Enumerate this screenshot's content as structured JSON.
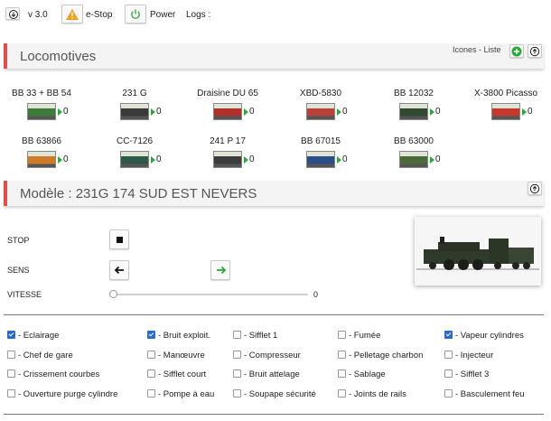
{
  "topbar": {
    "version": "v 3.0",
    "estop_label": "e-Stop",
    "power_label": "Power",
    "logs_label": "Logs :"
  },
  "locomotives_section": {
    "title": "Locomotives",
    "view_toggle": "Icones - Liste"
  },
  "locomotives": [
    {
      "name": "BB 33 + BB 54",
      "count": "0",
      "color": "#3e7a3a"
    },
    {
      "name": "231 G",
      "count": "0",
      "color": "#3a3a3a"
    },
    {
      "name": "Draisine DU 65",
      "count": "0",
      "color": "#b0302c"
    },
    {
      "name": "XBD-5830",
      "count": "0",
      "color": "#b8413a"
    },
    {
      "name": "BB 12032",
      "count": "0",
      "color": "#2f4a2f"
    },
    {
      "name": "X-3800 Picasso",
      "count": "0",
      "color": "#c43a2e"
    },
    {
      "name": "BB 63866",
      "count": "0",
      "color": "#d07a28"
    },
    {
      "name": "CC-7126",
      "count": "0",
      "color": "#2f5a4a"
    },
    {
      "name": "241 P 17",
      "count": "0",
      "color": "#3c3c3c"
    },
    {
      "name": "BB 67015",
      "count": "0",
      "color": "#2c4f8c"
    },
    {
      "name": "BB 63000",
      "count": "0",
      "color": "#4a6a3a"
    }
  ],
  "model_section": {
    "title": "Modèle : 231G 174 SUD EST NEVERS"
  },
  "controls": {
    "stop_label": "STOP",
    "sens_label": "SENS",
    "vitesse_label": "VITESSE",
    "speed_value": "0",
    "speed_fraction": 0
  },
  "functions": [
    {
      "label": "- Eclairage",
      "checked": true
    },
    {
      "label": "- Bruit exploit.",
      "checked": true
    },
    {
      "label": "- Sifflet 1",
      "checked": false
    },
    {
      "label": "- Fumée",
      "checked": false
    },
    {
      "label": "- Vapeur cylindres",
      "checked": true
    },
    {
      "label": "- Chef de gare",
      "checked": false
    },
    {
      "label": "- Manœuvre",
      "checked": false
    },
    {
      "label": "- Compresseur",
      "checked": false
    },
    {
      "label": "- Pelletage charbon",
      "checked": false
    },
    {
      "label": "- Injecteur",
      "checked": false
    },
    {
      "label": "- Crissement courbes",
      "checked": false
    },
    {
      "label": "- Sifflet court",
      "checked": false
    },
    {
      "label": "- Bruit attelage",
      "checked": false
    },
    {
      "label": "- Sablage",
      "checked": false
    },
    {
      "label": "- Sifflet 3",
      "checked": false
    },
    {
      "label": "- Ouverture purge cylindre",
      "checked": false
    },
    {
      "label": "- Pompe à eau",
      "checked": false
    },
    {
      "label": "- Soupape sécurité",
      "checked": false
    },
    {
      "label": "- Joints de rails",
      "checked": false
    },
    {
      "label": "- Basculement feu",
      "checked": false
    }
  ],
  "colors": {
    "accent_red": "#e0504a",
    "green": "#2aa838",
    "warning": "#f0a020"
  }
}
